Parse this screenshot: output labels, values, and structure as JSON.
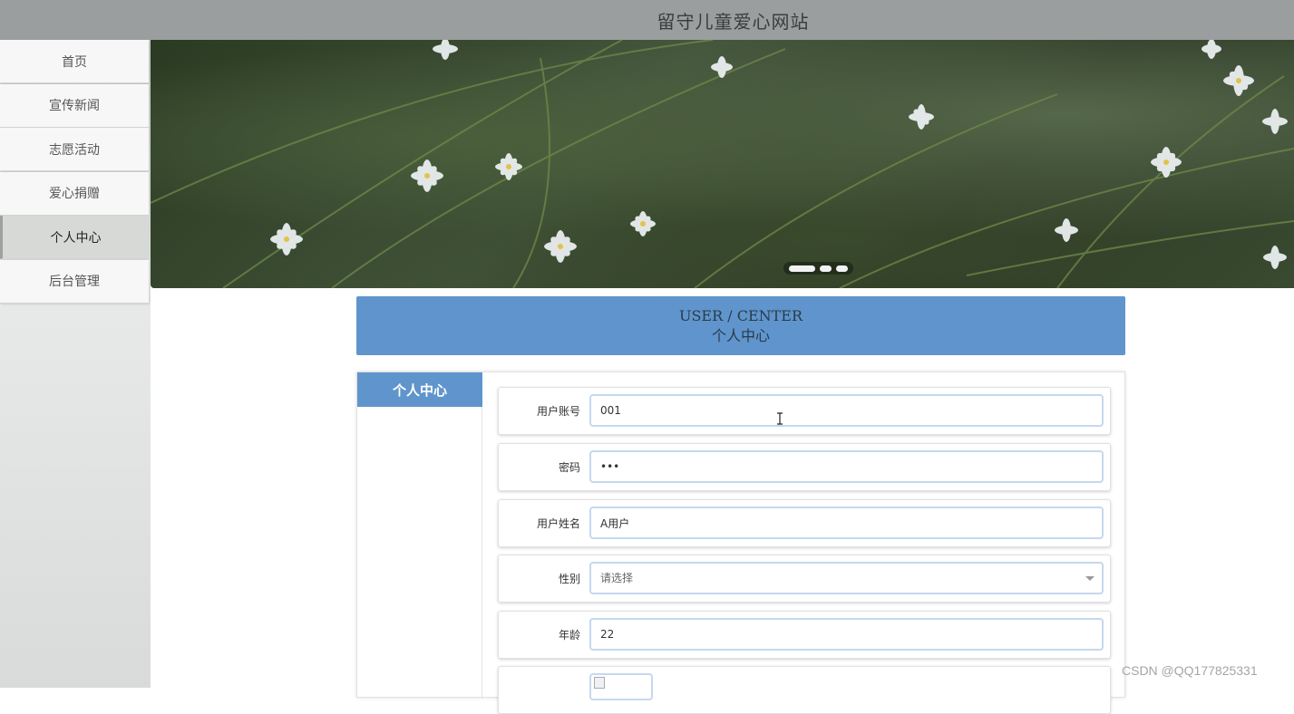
{
  "header": {
    "title": "留守儿童爱心网站"
  },
  "sidebar": {
    "items": [
      {
        "label": "首页",
        "active": false
      },
      {
        "label": "宣传新闻",
        "active": false
      },
      {
        "label": "志愿活动",
        "active": false
      },
      {
        "label": "爱心捐赠",
        "active": false
      },
      {
        "label": "个人中心",
        "active": true
      },
      {
        "label": "后台管理",
        "active": false
      }
    ]
  },
  "banner": {
    "slides": 3,
    "active_slide": 1
  },
  "section": {
    "title_en": "USER / CENTER",
    "title_cn": "个人中心"
  },
  "subnav": {
    "items": [
      {
        "label": "个人中心",
        "active": true
      }
    ]
  },
  "form": {
    "account": {
      "label": "用户账号",
      "value": "001"
    },
    "password": {
      "label": "密码",
      "value": "•••"
    },
    "name": {
      "label": "用户姓名",
      "value": "A用户"
    },
    "gender": {
      "label": "性别",
      "placeholder": "请选择",
      "options": [
        "请选择"
      ]
    },
    "age": {
      "label": "年龄",
      "value": "22"
    },
    "photo": {
      "label": ""
    }
  },
  "watermark": "CSDN @QQ177825331",
  "colors": {
    "accent": "#5f95cc",
    "header_bg": "#9b9e9e",
    "field_border": "#c5d8ee"
  },
  "icons": {
    "select_caret": "chevron-down-icon",
    "text_cursor": "i-beam-cursor-icon"
  }
}
